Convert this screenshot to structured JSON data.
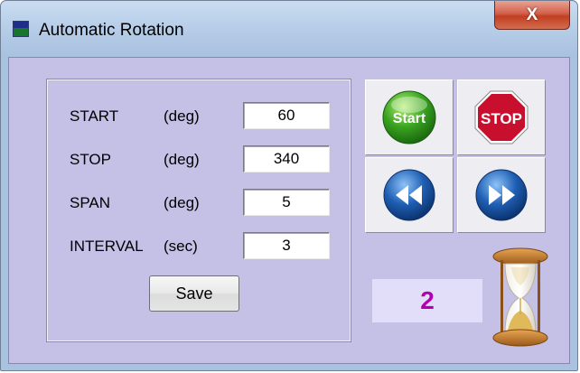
{
  "window": {
    "title": "Automatic Rotation",
    "close_label": "X"
  },
  "settings": {
    "rows": [
      {
        "label": "START",
        "unit": "(deg)",
        "value": "60"
      },
      {
        "label": "STOP",
        "unit": "(deg)",
        "value": "340"
      },
      {
        "label": "SPAN",
        "unit": "(deg)",
        "value": "5"
      },
      {
        "label": "INTERVAL",
        "unit": "(sec)",
        "value": "3"
      }
    ],
    "save_label": "Save"
  },
  "controls": {
    "start_label": "Start",
    "stop_label": "STOP"
  },
  "status": {
    "counter": "2"
  },
  "colors": {
    "counter_text": "#b000b0",
    "client_bg": "#c4c0e6",
    "start_green": "#3aa320",
    "stop_red": "#c8102e",
    "nav_blue": "#1f5fb4"
  },
  "icons": [
    "app-icon",
    "start-icon",
    "stop-sign-icon",
    "rewind-icon",
    "fast-forward-icon",
    "hourglass-icon"
  ]
}
